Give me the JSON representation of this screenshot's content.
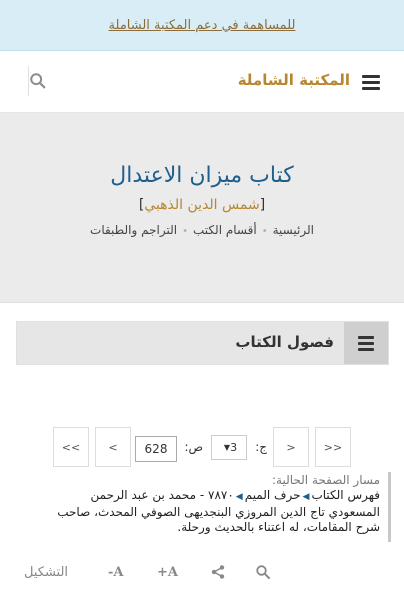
{
  "topbar": {
    "link_text": "للمساهمة في دعم المكتبة الشاملة"
  },
  "navbar": {
    "brand": "المكتبة الشاملة"
  },
  "book": {
    "title": "كتاب ميزان الاعتدال",
    "author": "شمس الدين الذهبي",
    "breadcrumb": [
      "الرئيسية",
      "أقسام الكتب",
      "التراجم والطبقات"
    ]
  },
  "chapters": {
    "label": "فصول الكتاب"
  },
  "pager": {
    "first": "<<",
    "prev": "<",
    "vol_label": "ج:",
    "vol_value": "3",
    "page_label": "ص:",
    "page_value": "628",
    "next": ">",
    "last": ">>"
  },
  "current_path": {
    "label": "مسار الصفحة الحالية:",
    "item1": "فهرس الكتاب",
    "item2": "حرف الميم",
    "item3": "٧٨٧٠ - محمد بن عبد الرحمن المسعودي تاج الدين المروزي البنجديهى الصوفي المحدث، صاحب شرح المقامات، له اعتناء بالحديث ورحلة."
  },
  "toolbar": {
    "increase": "A+",
    "decrease": "A-",
    "tashkeel": "التشكيل"
  },
  "icons": {
    "menu": "hamburger-menu-icon",
    "search": "magnifier-icon",
    "share": "share-icon",
    "arrow": "left-triangle-arrow-icon"
  },
  "colors": {
    "banner_bg": "#d9edf7",
    "brand": "#b8862f",
    "title_blue": "#1f5f8b",
    "hero_bg": "#ebebeb"
  }
}
